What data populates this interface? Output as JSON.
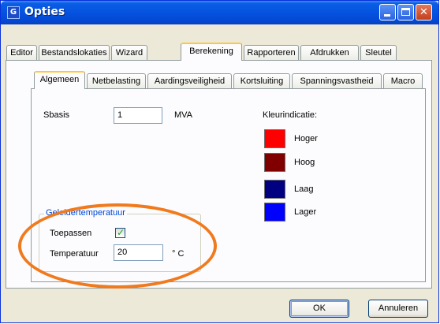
{
  "window": {
    "title": "Opties",
    "icon_text": "G",
    "icon": "app-icon"
  },
  "titlebar_buttons": {
    "minimize": "minimize-icon",
    "maximize": "maximize-icon",
    "close": "✕"
  },
  "main_tabs": [
    {
      "label": "Editor"
    },
    {
      "label": "Bestandslokaties"
    },
    {
      "label": "Wizard"
    },
    {
      "label": "Berekening",
      "active": true
    },
    {
      "label": "Rapporteren"
    },
    {
      "label": "Afdrukken"
    },
    {
      "label": "Sleutel"
    }
  ],
  "sub_tabs": [
    {
      "label": "Algemeen",
      "active": true
    },
    {
      "label": "Netbelasting"
    },
    {
      "label": "Aardingsveiligheid"
    },
    {
      "label": "Kortsluiting"
    },
    {
      "label": "Spanningsvastheid"
    },
    {
      "label": "Macro"
    }
  ],
  "sbasis": {
    "label": "Sbasis",
    "value": "1",
    "unit": "MVA"
  },
  "color_legend": {
    "title": "Kleurindicatie:",
    "items": [
      {
        "label": "Hoger",
        "color": "#ff0000"
      },
      {
        "label": "Hoog",
        "color": "#800000"
      },
      {
        "label": "Laag",
        "color": "#000080"
      },
      {
        "label": "Lager",
        "color": "#0000ff"
      }
    ]
  },
  "conductor_temperature": {
    "title": "Geleidertemperatuur",
    "apply_label": "Toepassen",
    "apply_checked": true,
    "temperature_label": "Temperatuur",
    "temperature_value": "20",
    "temperature_unit": "° C"
  },
  "buttons": {
    "ok": "OK",
    "cancel": "Annuleren"
  },
  "colors": {
    "titlebar": "#0553e0",
    "dialog_bg": "#ece9d8",
    "annotation": "#f07a1e",
    "group_title": "#0046d5"
  }
}
